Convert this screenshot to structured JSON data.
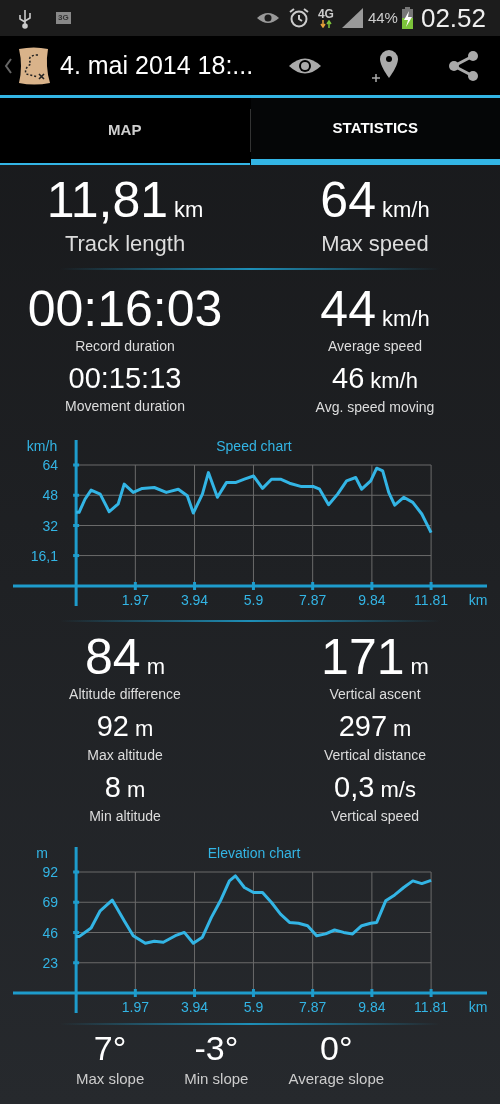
{
  "status_bar": {
    "data_badge": "3G",
    "network": "4G",
    "battery": "44%",
    "time": "02.52"
  },
  "app_bar": {
    "title": "4. mai 2014 18:..."
  },
  "tabs": [
    {
      "label": "MAP",
      "selected": false
    },
    {
      "label": "STATISTICS",
      "selected": true
    }
  ],
  "speed_stats": [
    {
      "kind": "hero",
      "items": [
        {
          "value": "11,81",
          "unit": "km",
          "label": "Track length"
        },
        {
          "value": "64",
          "unit": "km/h",
          "label": "Max speed"
        }
      ]
    },
    {
      "kind": "main",
      "items": [
        {
          "value": "00:16:03",
          "label": "Record duration"
        },
        {
          "value": "44",
          "unit": "km/h",
          "label": "Average speed"
        }
      ]
    },
    {
      "kind": "minor",
      "items": [
        {
          "value": "00:15:13",
          "label": "Movement duration"
        },
        {
          "value": "46",
          "unit": "km/h",
          "label": "Avg. speed moving"
        }
      ]
    }
  ],
  "speed_chart": {
    "chart_data": {
      "type": "line",
      "title": "Speed chart",
      "xlabel": "km",
      "ylabel": "km/h",
      "x": [
        0,
        0.1,
        0.3,
        0.5,
        0.8,
        1.1,
        1.4,
        1.6,
        1.9,
        2.2,
        2.6,
        3.0,
        3.4,
        3.7,
        3.9,
        4.2,
        4.4,
        4.7,
        5.0,
        5.3,
        5.6,
        5.9,
        6.2,
        6.5,
        6.8,
        7.1,
        7.5,
        7.9,
        8.1,
        8.4,
        8.7,
        9.0,
        9.3,
        9.5,
        9.8,
        10.0,
        10.2,
        10.4,
        10.6,
        10.9,
        11.2,
        11.5,
        11.81
      ],
      "series": [
        {
          "color": "#33b5e5",
          "values": [
            39,
            39,
            46,
            50.7,
            48.6,
            39.3,
            43.4,
            53.9,
            49.5,
            51.6,
            52.1,
            49.5,
            51.2,
            47.7,
            38.6,
            48.6,
            60,
            46.9,
            54.7,
            54.7,
            56.5,
            58.2,
            51.6,
            56.5,
            56.5,
            54.4,
            52.6,
            52.6,
            51.2,
            43,
            48.6,
            55.6,
            57.4,
            51.2,
            55.6,
            62.3,
            60.9,
            49.5,
            42.8,
            46.9,
            44.2,
            38.1,
            28.2
          ]
        }
      ],
      "xlim": [
        -2.1,
        13.67
      ],
      "ylim": [
        0,
        64
      ],
      "grid": true,
      "xticks": [
        1.97,
        3.94,
        5.9,
        7.87,
        9.84,
        11.81
      ],
      "yticks": [
        {
          "value": 16.1,
          "label": "16,1"
        },
        32,
        48,
        64
      ]
    }
  },
  "altitude_stats": [
    {
      "kind": "main",
      "items": [
        {
          "value": "84",
          "unit": "m",
          "label": "Altitude difference"
        },
        {
          "value": "171",
          "unit": "m",
          "label": "Vertical ascent"
        }
      ]
    },
    {
      "kind": "minor",
      "items": [
        {
          "value": "92",
          "unit": "m",
          "label": "Max altitude"
        },
        {
          "value": "297",
          "unit": "m",
          "label": "Vertical distance"
        }
      ]
    },
    {
      "kind": "minor",
      "items": [
        {
          "value": "8",
          "unit": "m",
          "label": "Min altitude"
        },
        {
          "value": "0,3",
          "unit": "m/s",
          "label": "Vertical speed"
        }
      ]
    }
  ],
  "elevation_chart": {
    "chart_data": {
      "type": "line",
      "title": "Elevation chart",
      "xlabel": "km",
      "ylabel": "m",
      "x": [
        0,
        0.1,
        0.5,
        0.8,
        1.2,
        1.6,
        1.9,
        2.3,
        2.6,
        2.9,
        3.3,
        3.6,
        3.9,
        4.2,
        4.5,
        4.8,
        5.1,
        5.3,
        5.6,
        5.9,
        6.2,
        6.5,
        6.8,
        7.1,
        7.4,
        7.7,
        8.0,
        8.3,
        8.6,
        8.9,
        9.2,
        9.5,
        9.8,
        10.0,
        10.3,
        10.6,
        10.9,
        11.2,
        11.5,
        11.81
      ],
      "series": [
        {
          "color": "#33b5e5",
          "values": [
            42.9,
            42.9,
            49.4,
            62.5,
            70.6,
            55,
            43.6,
            37.8,
            39.3,
            38.6,
            43.6,
            46.1,
            37.8,
            42.4,
            57.5,
            70.1,
            85.2,
            89,
            80.2,
            76.4,
            76.4,
            68.8,
            60,
            53.7,
            53,
            51.2,
            43.6,
            44.9,
            47.9,
            46.1,
            44.9,
            51.2,
            53,
            53.7,
            70.1,
            74.6,
            80.2,
            85.2,
            83.2,
            85.7
          ]
        }
      ],
      "xlim": [
        -2.1,
        13.67
      ],
      "ylim": [
        0,
        92
      ],
      "grid": true,
      "xticks": [
        1.97,
        3.94,
        5.9,
        7.87,
        9.84,
        11.81
      ],
      "yticks": [
        23,
        46,
        69,
        92
      ]
    }
  },
  "slope_stats": [
    {
      "value": "7°",
      "label": "Max slope"
    },
    {
      "value": "-3°",
      "label": "Min slope"
    },
    {
      "value": "0°",
      "label": "Average slope"
    }
  ]
}
